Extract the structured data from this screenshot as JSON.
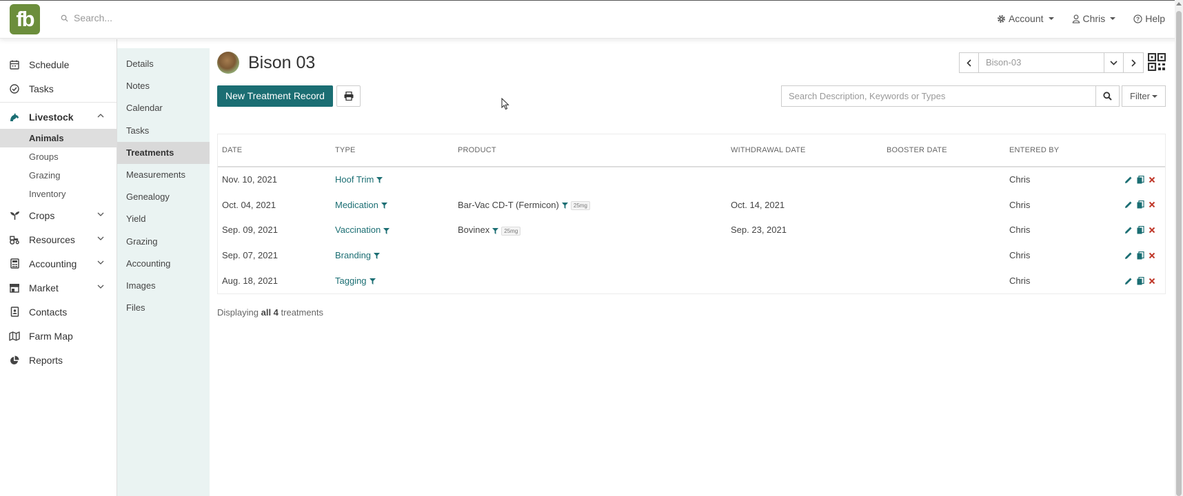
{
  "topbar": {
    "logo_text": "fb",
    "search_placeholder": "Search...",
    "account_label": "Account",
    "user_label": "Chris",
    "help_label": "Help"
  },
  "sidebar": {
    "items": [
      {
        "label": "Schedule",
        "icon": "calendar-icon"
      },
      {
        "label": "Tasks",
        "icon": "check-circle-icon"
      },
      {
        "label": "Livestock",
        "icon": "horse-icon"
      },
      {
        "label": "Crops",
        "icon": "seedling-icon"
      },
      {
        "label": "Resources",
        "icon": "tractor-icon"
      },
      {
        "label": "Accounting",
        "icon": "calculator-icon"
      },
      {
        "label": "Market",
        "icon": "store-icon"
      },
      {
        "label": "Contacts",
        "icon": "address-book-icon"
      },
      {
        "label": "Farm Map",
        "icon": "map-icon"
      },
      {
        "label": "Reports",
        "icon": "pie-chart-icon"
      }
    ],
    "livestock_sub": [
      "Animals",
      "Groups",
      "Grazing",
      "Inventory"
    ]
  },
  "subnav": {
    "items": [
      "Details",
      "Notes",
      "Calendar",
      "Tasks",
      "Treatments",
      "Measurements",
      "Genealogy",
      "Yield",
      "Grazing",
      "Accounting",
      "Images",
      "Files"
    ]
  },
  "page": {
    "title": "Bison 03",
    "animal_picker_value": "Bison-03",
    "new_button": "New Treatment Record",
    "search_placeholder": "Search Description, Keywords or Types",
    "filter_label": "Filter"
  },
  "table": {
    "headers": [
      "DATE",
      "TYPE",
      "PRODUCT",
      "WITHDRAWAL DATE",
      "BOOSTER DATE",
      "ENTERED BY"
    ],
    "rows": [
      {
        "date": "Nov. 10, 2021",
        "type": "Hoof Trim",
        "product": "",
        "dose": "",
        "withdrawal": "",
        "booster": "",
        "entered_by": "Chris"
      },
      {
        "date": "Oct. 04, 2021",
        "type": "Medication",
        "product": "Bar-Vac CD-T (Fermicon)",
        "dose": "25mg",
        "withdrawal": "Oct. 14, 2021",
        "booster": "",
        "entered_by": "Chris"
      },
      {
        "date": "Sep. 09, 2021",
        "type": "Vaccination",
        "product": "Bovinex",
        "dose": "25mg",
        "withdrawal": "Sep. 23, 2021",
        "booster": "",
        "entered_by": "Chris"
      },
      {
        "date": "Sep. 07, 2021",
        "type": "Branding",
        "product": "",
        "dose": "",
        "withdrawal": "",
        "booster": "",
        "entered_by": "Chris"
      },
      {
        "date": "Aug. 18, 2021",
        "type": "Tagging",
        "product": "",
        "dose": "",
        "withdrawal": "",
        "booster": "",
        "entered_by": "Chris"
      }
    ]
  },
  "footer": {
    "prefix": "Displaying",
    "count_text": "all 4",
    "suffix": "treatments"
  },
  "colors": {
    "brand_green": "#6c8e3c",
    "teal": "#1b6e73",
    "subnav_bg": "#eaf3f2",
    "delete_red": "#c0392b"
  }
}
